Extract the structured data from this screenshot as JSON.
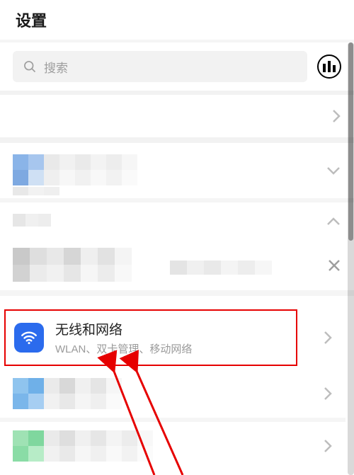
{
  "header": {
    "title": "设置"
  },
  "search": {
    "placeholder": "搜索"
  },
  "network": {
    "title": "无线和网络",
    "subtitle": "WLAN、双卡管理、移动网络"
  }
}
